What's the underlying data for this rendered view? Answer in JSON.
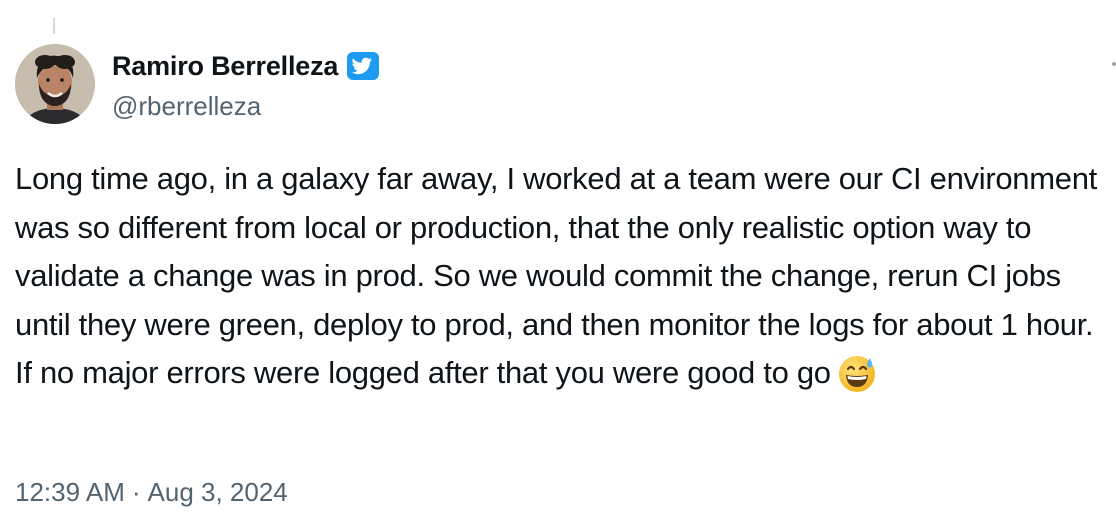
{
  "author": {
    "display_name": "Ramiro Berrelleza",
    "handle": "@rberrelleza",
    "verified_icon": "verified-badge-icon",
    "avatar": "avatar-photo"
  },
  "tweet": {
    "text": "Long time ago, in a galaxy far away, I worked at a team were our CI environment was so different from local or production, that the only realistic option way to validate a change was in prod. So we would commit the change, rerun CI jobs until they were green, deploy to prod, and then monitor the logs for about 1 hour.  If no major errors were logged after that you were good to go",
    "emoji": "grinning-face-with-sweat-emoji"
  },
  "meta": {
    "time": "12:39 AM",
    "separator": "·",
    "date": "Aug 3, 2024"
  },
  "colors": {
    "text_primary": "#0f1419",
    "text_secondary": "#536471",
    "verified_blue": "#1d9bf0",
    "background": "#ffffff"
  }
}
